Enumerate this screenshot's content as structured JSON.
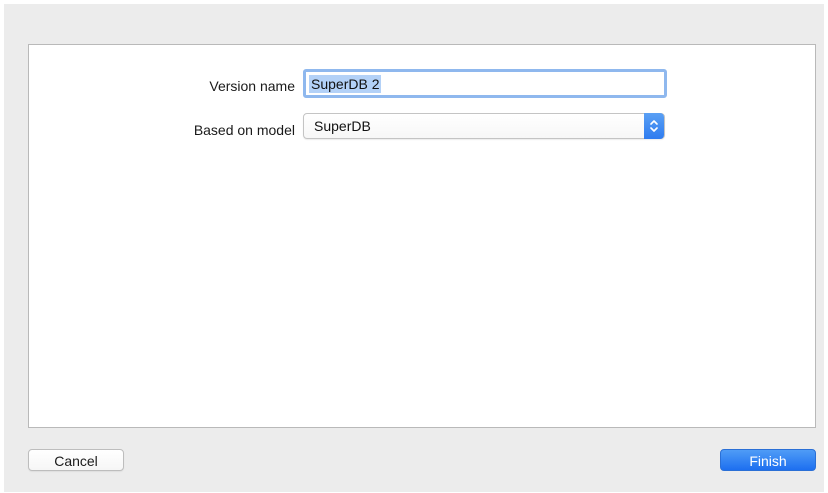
{
  "form": {
    "version_name": {
      "label": "Version name",
      "value": "SuperDB 2",
      "selected": true
    },
    "based_on_model": {
      "label": "Based on model",
      "selected_value": "SuperDB"
    }
  },
  "footer": {
    "cancel_label": "Cancel",
    "finish_label": "Finish"
  },
  "colors": {
    "accent": "#2f7cf0",
    "selection": "#b3d1f7",
    "focus_ring": "#8fb8ee",
    "sheet_background": "#ececec",
    "panel_background": "#ffffff"
  },
  "icons": {
    "popup": "up-down-chevron-icon"
  }
}
